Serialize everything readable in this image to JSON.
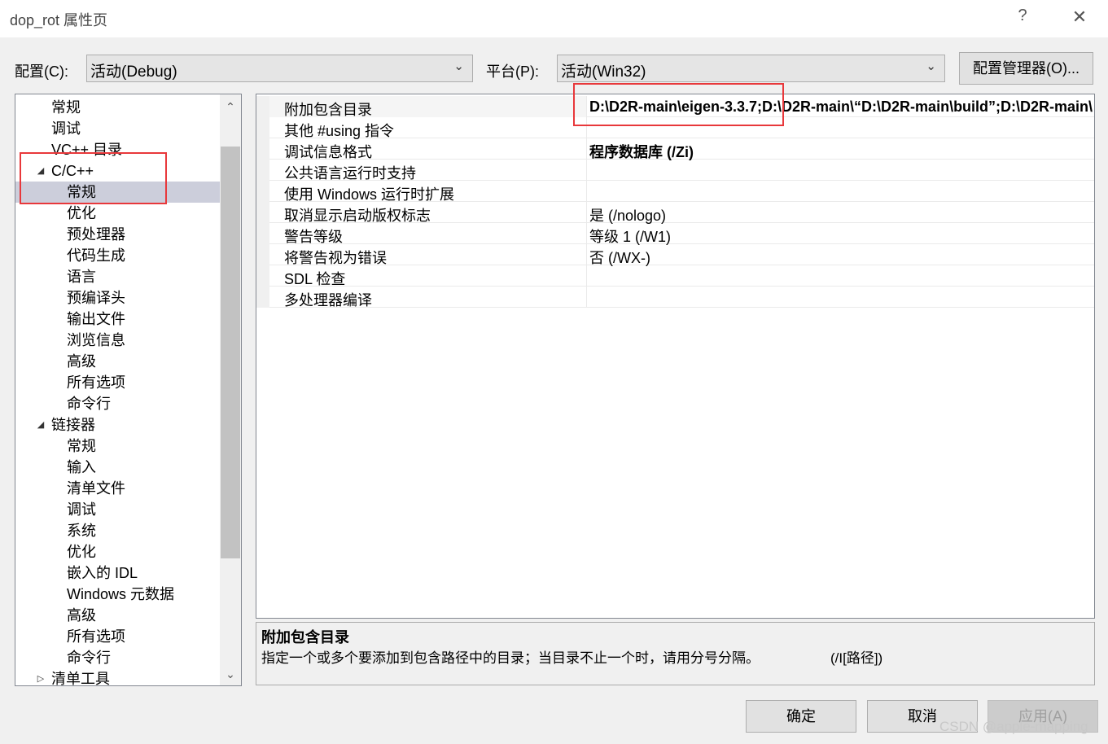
{
  "window": {
    "title": "dop_rot 属性页",
    "help_glyph": "?",
    "close_glyph": "✕"
  },
  "toolbar": {
    "config_label": "配置(C):",
    "config_value": "活动(Debug)",
    "platform_label": "平台(P):",
    "platform_value": "活动(Win32)",
    "config_manager_label": "配置管理器(O)..."
  },
  "tree": {
    "items": [
      {
        "label": "常规",
        "level": 1
      },
      {
        "label": "调试",
        "level": 1
      },
      {
        "label": "VC++ 目录",
        "level": 1
      },
      {
        "label": "C/C++",
        "level": 0,
        "expanded": true
      },
      {
        "label": "常规",
        "level": 2,
        "selected": true
      },
      {
        "label": "优化",
        "level": 2
      },
      {
        "label": "预处理器",
        "level": 2
      },
      {
        "label": "代码生成",
        "level": 2
      },
      {
        "label": "语言",
        "level": 2
      },
      {
        "label": "预编译头",
        "level": 2
      },
      {
        "label": "输出文件",
        "level": 2
      },
      {
        "label": "浏览信息",
        "level": 2
      },
      {
        "label": "高级",
        "level": 2
      },
      {
        "label": "所有选项",
        "level": 2
      },
      {
        "label": "命令行",
        "level": 2
      },
      {
        "label": "链接器",
        "level": 0,
        "expanded": true
      },
      {
        "label": "常规",
        "level": 2
      },
      {
        "label": "输入",
        "level": 2
      },
      {
        "label": "清单文件",
        "level": 2
      },
      {
        "label": "调试",
        "level": 2
      },
      {
        "label": "系统",
        "level": 2
      },
      {
        "label": "优化",
        "level": 2
      },
      {
        "label": "嵌入的 IDL",
        "level": 2
      },
      {
        "label": "Windows 元数据",
        "level": 2
      },
      {
        "label": "高级",
        "level": 2
      },
      {
        "label": "所有选项",
        "level": 2
      },
      {
        "label": "命令行",
        "level": 2
      },
      {
        "label": "清单工具",
        "level": 0,
        "expanded": false
      }
    ]
  },
  "properties": {
    "rows": [
      {
        "name": "附加包含目录",
        "value": "D:\\D2R-main\\eigen-3.3.7;D:\\D2R-main\\“D:\\D2R-main\\build”;D:\\D2R-main\\",
        "bold": true,
        "selected": true
      },
      {
        "name": "其他 #using 指令",
        "value": "",
        "bold": false
      },
      {
        "name": "调试信息格式",
        "value": "程序数据库 (/Zi)",
        "bold": true
      },
      {
        "name": "公共语言运行时支持",
        "value": "",
        "bold": false
      },
      {
        "name": "使用 Windows 运行时扩展",
        "value": "",
        "bold": false
      },
      {
        "name": "取消显示启动版权标志",
        "value": "是 (/nologo)",
        "bold": false
      },
      {
        "name": "警告等级",
        "value": "等级 1 (/W1)",
        "bold": false
      },
      {
        "name": "将警告视为错误",
        "value": "否 (/WX-)",
        "bold": false
      },
      {
        "name": "SDL 检查",
        "value": "",
        "bold": false
      },
      {
        "name": "多处理器编译",
        "value": "",
        "bold": false
      }
    ]
  },
  "description": {
    "title": "附加包含目录",
    "text": "指定一个或多个要添加到包含路径中的目录；当目录不止一个时，请用分号分隔。",
    "switch": "(/I[路径])"
  },
  "buttons": {
    "ok": "确定",
    "cancel": "取消",
    "apply": "应用(A)"
  },
  "watermark": "CSDN @apple-mapping",
  "colors": {
    "highlight_box": "#e8383b",
    "tree_selected": "#cccedb"
  }
}
